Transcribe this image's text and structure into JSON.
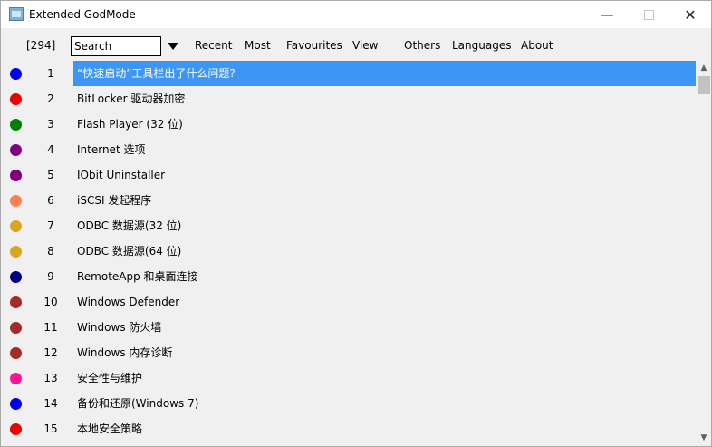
{
  "window": {
    "title": "Extended GodMode",
    "minimize_label": "—",
    "close_label": "✕"
  },
  "toolbar": {
    "count": "[294]",
    "search_value": "Search",
    "menus": [
      "Recent",
      "Most",
      "Favourites",
      "View",
      "Others",
      "Languages",
      "About"
    ]
  },
  "colors": {
    "selection": "#3d95f5",
    "scroll_thumb": "#c2c2c2"
  },
  "list": {
    "selected_index": 0,
    "items": [
      {
        "num": "1",
        "label": "“快速启动”工具栏出了什么问题?",
        "color": "#0000ee"
      },
      {
        "num": "2",
        "label": "BitLocker 驱动器加密",
        "color": "#ee0000"
      },
      {
        "num": "3",
        "label": "Flash Player (32 位)",
        "color": "#008000"
      },
      {
        "num": "4",
        "label": "Internet 选项",
        "color": "#800080"
      },
      {
        "num": "5",
        "label": "IObit Uninstaller",
        "color": "#800080"
      },
      {
        "num": "6",
        "label": "iSCSI 发起程序",
        "color": "#ff7f50"
      },
      {
        "num": "7",
        "label": "ODBC 数据源(32 位)",
        "color": "#daa520"
      },
      {
        "num": "8",
        "label": "ODBC 数据源(64 位)",
        "color": "#daa520"
      },
      {
        "num": "9",
        "label": "RemoteApp 和桌面连接",
        "color": "#000080"
      },
      {
        "num": "10",
        "label": "Windows Defender",
        "color": "#a52a2a"
      },
      {
        "num": "11",
        "label": "Windows 防火墙",
        "color": "#a52a2a"
      },
      {
        "num": "12",
        "label": "Windows 内存诊断",
        "color": "#a52a2a"
      },
      {
        "num": "13",
        "label": "安全性与维护",
        "color": "#ff1493"
      },
      {
        "num": "14",
        "label": "备份和还原(Windows 7)",
        "color": "#0000ee"
      },
      {
        "num": "15",
        "label": "本地安全策略",
        "color": "#ee0000"
      }
    ]
  }
}
